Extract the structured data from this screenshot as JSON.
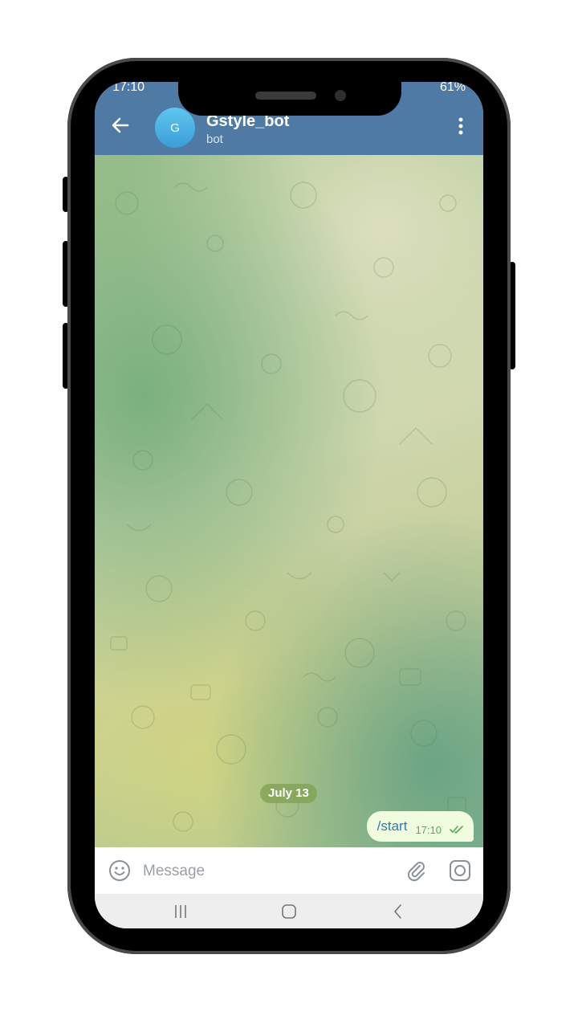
{
  "status_bar": {
    "time": "17:10",
    "battery": "61%"
  },
  "header": {
    "avatar_letter": "G",
    "title": "Gstyle_bot",
    "subtitle": "bot"
  },
  "chat": {
    "date_separator": "July 13",
    "messages": [
      {
        "text": "/start",
        "time": "17:10",
        "status": "read"
      }
    ]
  },
  "composer": {
    "placeholder": "Message"
  },
  "icons": {
    "back": "arrow-left-icon",
    "menu": "more-vertical-icon",
    "emoji": "smiley-icon",
    "attach": "paperclip-icon",
    "camera": "camera-icon",
    "nav_recents": "recents-icon",
    "nav_home": "home-icon",
    "nav_back": "nav-back-icon"
  },
  "colors": {
    "header": "#4f7aa4",
    "bubble": "#effdde",
    "bubble_text": "#2f7ab5",
    "bubble_time": "#5ea85c"
  }
}
